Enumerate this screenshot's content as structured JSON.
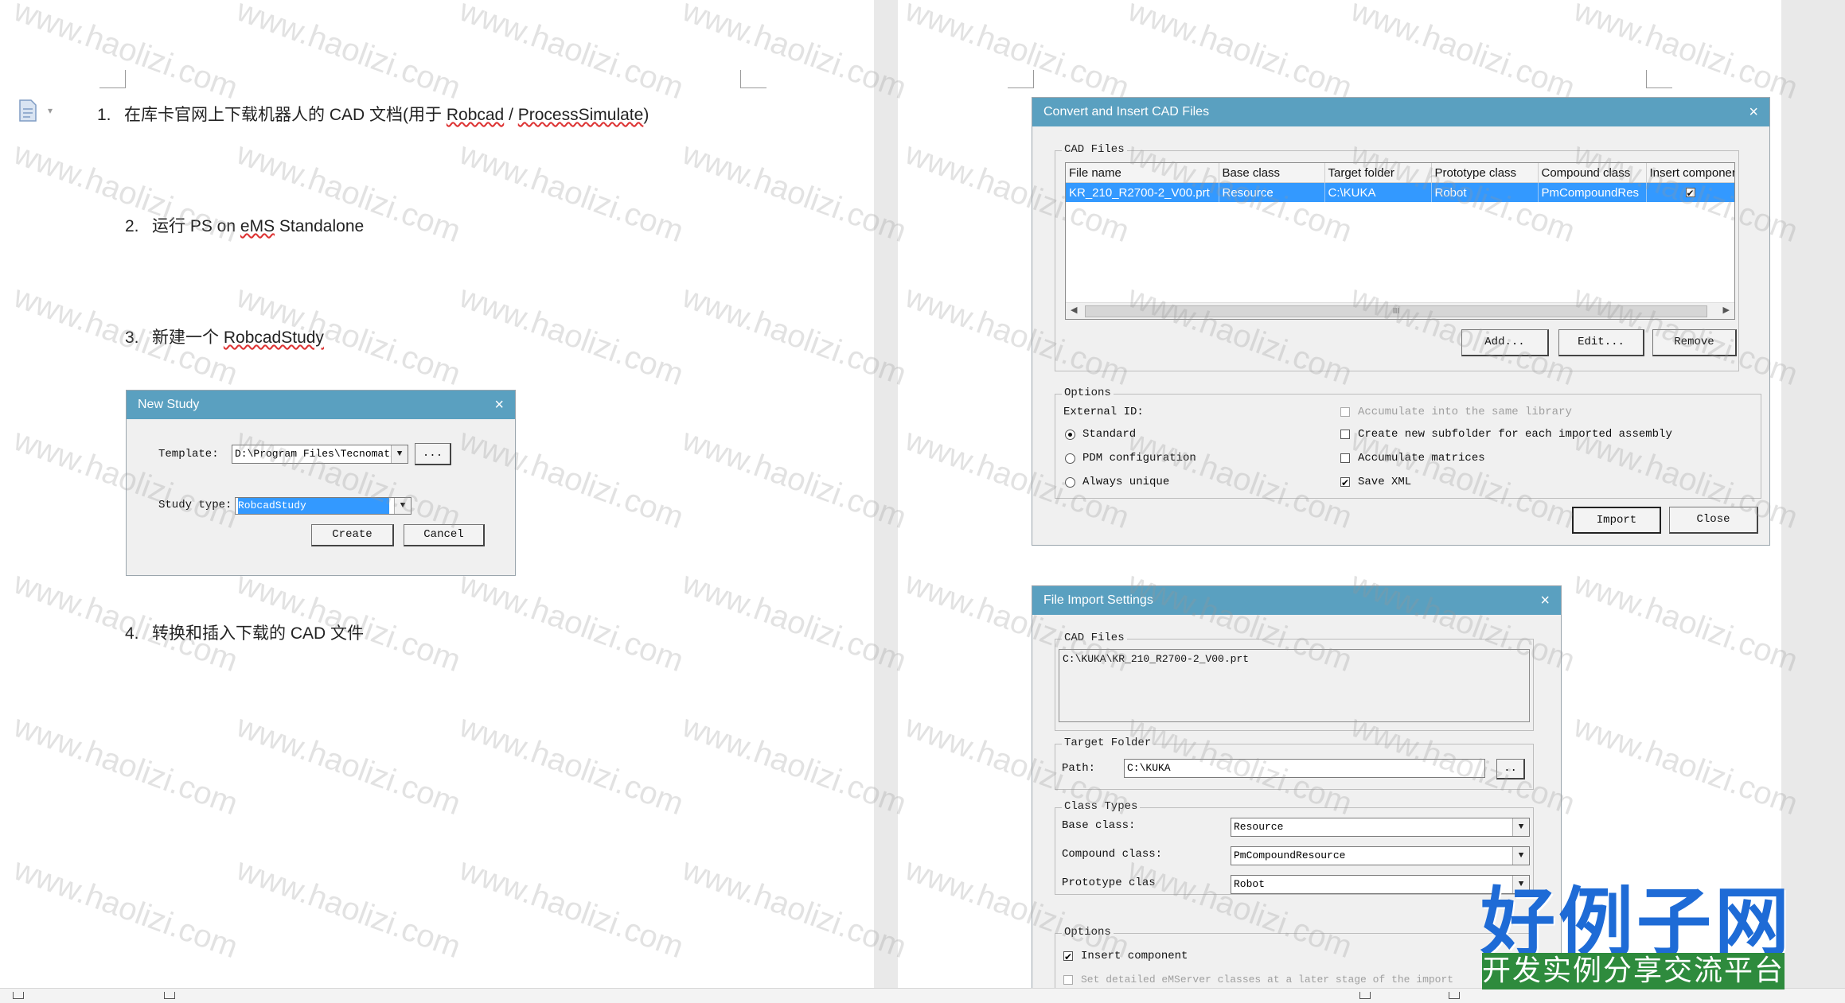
{
  "watermark": "www.haolizi.com",
  "doc": {
    "steps": [
      {
        "num": "1.",
        "text": "在库卡官网上下载机器人的 CAD 文档(用于 ",
        "link1": "Robcad",
        "sep": " / ",
        "link2": "ProcessSimulate",
        "tail": ")"
      },
      {
        "num": "2.",
        "text": "运行 PS on ",
        "link1": "eMS",
        "tail": " Standalone"
      },
      {
        "num": "3.",
        "text": "新建一个 ",
        "link1": "RobcadStudy"
      },
      {
        "num": "4.",
        "text": "转换和插入下载的 CAD 文件"
      }
    ]
  },
  "new_study": {
    "title": "New Study",
    "close": "×",
    "template_label": "Template:",
    "template_value": "D:\\Program Files\\Tecnomatix_",
    "browse": "...",
    "study_type_label": "Study type:",
    "study_type_value": "RobcadStudy",
    "create": "Create",
    "cancel": "Cancel"
  },
  "convert": {
    "title": "Convert and Insert CAD Files",
    "close": "×",
    "cad_files_group": "CAD Files",
    "columns": [
      "File name",
      "Base class",
      "Target folder",
      "Prototype class",
      "Compound class",
      "Insert componer"
    ],
    "rows": [
      {
        "file": "KR_210_R2700-2_V00.prt",
        "base": "Resource",
        "target": "C:\\KUKA",
        "proto": "Robot",
        "compound": "PmCompoundRes",
        "insert": "✔"
      }
    ],
    "scroll_mark": "III",
    "add": "Add...",
    "edit": "Edit...",
    "remove": "Remove",
    "options_group": "Options",
    "external_id": "External ID:",
    "radio_standard": "Standard",
    "radio_pdm": "PDM configuration",
    "radio_unique": "Always unique",
    "opt_accumulate_lib": "Accumulate into the same library",
    "opt_subfolder": "Create new subfolder for each imported assembly",
    "opt_matrices": "Accumulate matrices",
    "opt_save_xml": "Save XML",
    "import": "Import",
    "close_btn": "Close"
  },
  "file_import": {
    "title": "File Import Settings",
    "close": "×",
    "cad_files_group": "CAD Files",
    "cad_file_path": "C:\\KUKA\\KR_210_R2700-2_V00.prt",
    "target_group": "Target Folder",
    "path_label": "Path:",
    "path_value": "C:\\KUKA",
    "browse": "..",
    "class_group": "Class Types",
    "base_label": "Base class:",
    "base_value": "Resource",
    "compound_label": "Compound class:",
    "compound_value": "PmCompoundResource",
    "proto_label": "Prototype clas",
    "proto_value": "Robot",
    "options_group": "Options",
    "insert_component": "Insert component",
    "set_detailed": "Set detailed eMServer classes at a later stage of the import"
  },
  "logo": {
    "main": "好例子网",
    "sub": "开发实例分享交流平台"
  }
}
